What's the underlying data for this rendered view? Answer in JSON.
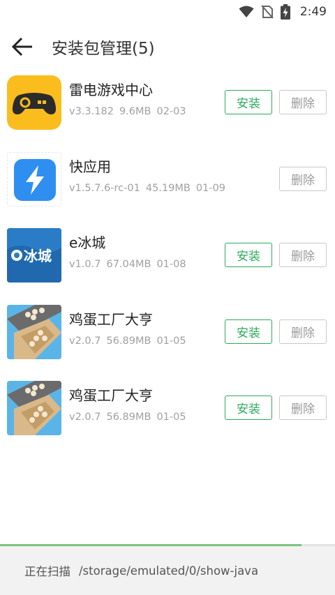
{
  "status_bar": {
    "time": "2:49",
    "icons": [
      "wifi-icon",
      "no-sim-icon",
      "battery-charging-icon"
    ]
  },
  "header": {
    "title": "安装包管理(5)",
    "back_icon": "arrow-left-icon"
  },
  "colors": {
    "accent_green": "#2ea95b",
    "delete_gray": "#c8c8c8",
    "progress_green": "#7cc57f"
  },
  "apps": [
    {
      "name": "雷电游戏中心",
      "version": "v3.3.182",
      "size": "9.6MB",
      "date": "02-03",
      "icon": "gamepad-icon",
      "install_label": "安装",
      "delete_label": "删除"
    },
    {
      "name": "快应用",
      "version": "v1.5.7.6-rc-01",
      "size": "45.19MB",
      "date": "01-09",
      "icon": "lightning-icon",
      "delete_label": "删除"
    },
    {
      "name": "e冰城",
      "version": "v1.0.7",
      "size": "67.04MB",
      "date": "01-08",
      "icon": "ebingcheng-logo-icon",
      "icon_text": "冰城",
      "install_label": "安装",
      "delete_label": "删除"
    },
    {
      "name": "鸡蛋工厂大亨",
      "version": "v2.0.7",
      "size": "56.89MB",
      "date": "01-05",
      "icon": "egg-factory-icon",
      "install_label": "安装",
      "delete_label": "删除"
    },
    {
      "name": "鸡蛋工厂大亨",
      "version": "v2.0.7",
      "size": "56.89MB",
      "date": "01-05",
      "icon": "egg-factory-icon",
      "install_label": "安装",
      "delete_label": "删除"
    }
  ],
  "scan": {
    "label": "正在扫描",
    "path": "/storage/emulated/0/show-java",
    "progress_percent": 90
  }
}
